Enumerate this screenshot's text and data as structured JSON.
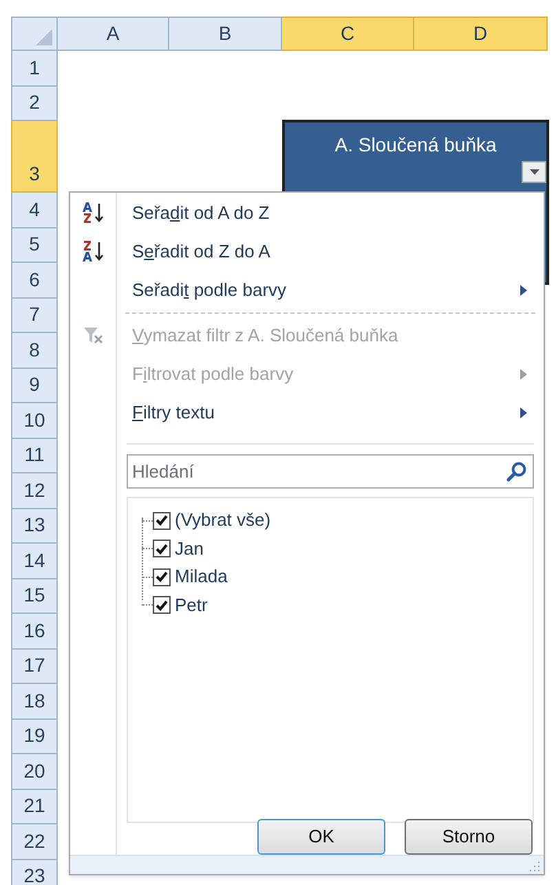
{
  "sheet": {
    "columns": [
      {
        "label": "A",
        "selected": false
      },
      {
        "label": "B",
        "selected": false
      },
      {
        "label": "C",
        "selected": true
      },
      {
        "label": "D",
        "selected": true
      }
    ],
    "rows": [
      {
        "label": "1",
        "selected": false
      },
      {
        "label": "2",
        "selected": false
      },
      {
        "label": "3",
        "selected": true
      },
      {
        "label": "4",
        "selected": false
      },
      {
        "label": "5",
        "selected": false
      },
      {
        "label": "6",
        "selected": false
      },
      {
        "label": "7",
        "selected": false
      },
      {
        "label": "8",
        "selected": false
      },
      {
        "label": "9",
        "selected": false
      },
      {
        "label": "10",
        "selected": false
      },
      {
        "label": "11",
        "selected": false
      },
      {
        "label": "12",
        "selected": false
      },
      {
        "label": "13",
        "selected": false
      },
      {
        "label": "14",
        "selected": false
      },
      {
        "label": "15",
        "selected": false
      },
      {
        "label": "16",
        "selected": false
      },
      {
        "label": "17",
        "selected": false
      },
      {
        "label": "18",
        "selected": false
      },
      {
        "label": "19",
        "selected": false
      },
      {
        "label": "20",
        "selected": false
      },
      {
        "label": "21",
        "selected": false
      },
      {
        "label": "22",
        "selected": false
      },
      {
        "label": "23",
        "selected": false
      }
    ],
    "merged_cell": {
      "text": "A. Sloučená buňka"
    }
  },
  "filter_menu": {
    "sections": [
      [
        {
          "kind": "sort_ascending",
          "label": {
            "before": "Seřa",
            "key": "d",
            "after": "it od A do Z"
          },
          "disabled": false,
          "submenu": false
        },
        {
          "kind": "sort_descending",
          "label": {
            "before": "S",
            "key": "e",
            "after": "řadit od Z do A"
          },
          "disabled": false,
          "submenu": false
        },
        {
          "kind": "plain",
          "label": {
            "before": "Seřadi",
            "key": "t",
            "after": " podle barvy"
          },
          "disabled": false,
          "submenu": true
        }
      ],
      [
        {
          "kind": "clear_filter",
          "label": {
            "key": "V",
            "after": "ymazat filtr z A. Sloučená buňka"
          },
          "disabled": true,
          "submenu": false
        },
        {
          "kind": "plain",
          "label": {
            "before": "F",
            "key": "i",
            "after": "ltrovat podle barvy"
          },
          "disabled": true,
          "submenu": true
        },
        {
          "kind": "plain",
          "label": {
            "key": "F",
            "after": "iltry textu"
          },
          "disabled": false,
          "submenu": true
        }
      ]
    ],
    "search": {
      "placeholder": "Hledání"
    },
    "values": [
      {
        "label": "(Vybrat vše)",
        "checked": true
      },
      {
        "label": "Jan",
        "checked": true
      },
      {
        "label": "Milada",
        "checked": true
      },
      {
        "label": "Petr",
        "checked": true
      }
    ],
    "buttons": [
      "OK",
      "Storno"
    ]
  }
}
